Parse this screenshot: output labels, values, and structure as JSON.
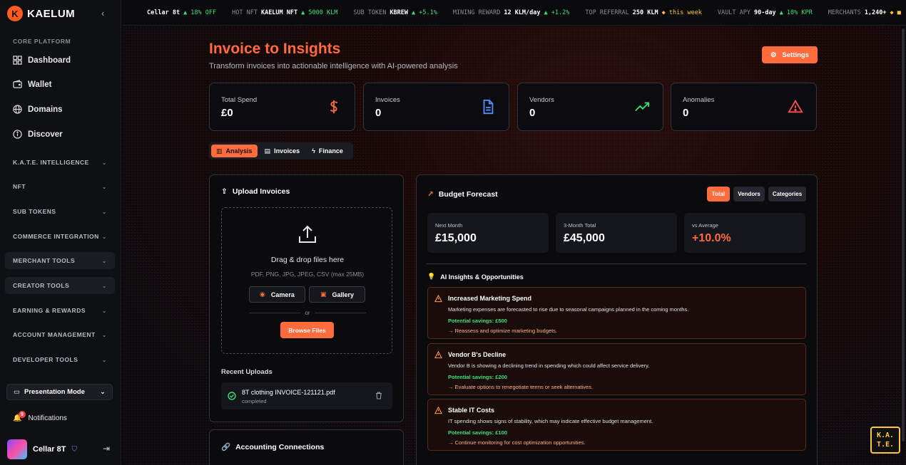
{
  "brand": {
    "name": "KAELUM",
    "logo_letter": "K"
  },
  "sidebar": {
    "core_label": "CORE PLATFORM",
    "items": [
      {
        "label": "Dashboard",
        "icon": "grid-icon"
      },
      {
        "label": "Wallet",
        "icon": "wallet-icon"
      },
      {
        "label": "Domains",
        "icon": "globe-icon"
      },
      {
        "label": "Discover",
        "icon": "compass-icon"
      }
    ],
    "groups": [
      "K.A.T.E. INTELLIGENCE",
      "NFT",
      "SUB TOKENS",
      "COMMERCE INTEGRATION",
      "MERCHANT TOOLS",
      "CREATOR TOOLS",
      "EARNING & REWARDS",
      "ACCOUNT MANAGEMENT",
      "DEVELOPER TOOLS"
    ],
    "presentation_mode": "Presentation Mode",
    "notifications": "Notifications",
    "notif_count": "9",
    "user_name": "Cellar 8T"
  },
  "ticker": [
    {
      "k": "",
      "v": "Cellar 8t",
      "d": "▲ 18% OFF",
      "c": "up"
    },
    {
      "k": "HOT NFT",
      "v": "KAELUM NFT",
      "d": "▲ 5000 KLM",
      "c": "up"
    },
    {
      "k": "SUB TOKEN",
      "v": "KBREW",
      "d": "▲ +5.1%",
      "c": "up"
    },
    {
      "k": "MINING REWARD",
      "v": "12 KLM/day",
      "d": "▲ +1.2%",
      "c": "up"
    },
    {
      "k": "TOP REFERRAL",
      "v": "250 KLM",
      "d": "◆ this week",
      "c": "gold"
    },
    {
      "k": "VAULT APY",
      "v": "90-day",
      "d": "▲ 10% KPR",
      "c": "up"
    },
    {
      "k": "MERCHANTS",
      "v": "1,240+",
      "d": "◆ ■",
      "c": "gold"
    }
  ],
  "header": {
    "title": "Invoice to Insights",
    "subtitle": "Transform invoices into actionable intelligence with AI-powered analysis",
    "settings": "Settings"
  },
  "stats": [
    {
      "label": "Total Spend",
      "value": "£0",
      "icon": "dollar-icon",
      "color": "#ff6b3d"
    },
    {
      "label": "Invoices",
      "value": "0",
      "icon": "document-icon",
      "color": "#4d8dff"
    },
    {
      "label": "Vendors",
      "value": "0",
      "icon": "trend-up-icon",
      "color": "#3ee07a"
    },
    {
      "label": "Anomalies",
      "value": "0",
      "icon": "warning-icon",
      "color": "#ff4d4d"
    }
  ],
  "tabs": [
    {
      "label": "Analysis",
      "active": true
    },
    {
      "label": "Invoices",
      "active": false
    },
    {
      "label": "Finance",
      "active": false
    }
  ],
  "upload": {
    "title": "Upload Invoices",
    "drag_text": "Drag & drop files here",
    "formats": "PDF, PNG, JPG, JPEG, CSV (max 25MB)",
    "camera": "Camera",
    "gallery": "Gallery",
    "or": "or",
    "browse": "Browse Files",
    "recent_label": "Recent Uploads",
    "recent": [
      {
        "name": "8T clothing INVOICE-121121.pdf",
        "status": "completed"
      }
    ]
  },
  "accounting": {
    "title": "Accounting Connections"
  },
  "forecast": {
    "title": "Budget Forecast",
    "segments": [
      {
        "label": "Total",
        "active": true
      },
      {
        "label": "Vendors",
        "active": false
      },
      {
        "label": "Categories",
        "active": false
      }
    ],
    "cards": [
      {
        "label": "Next Month",
        "value": "£15,000"
      },
      {
        "label": "3-Month Total",
        "value": "£45,000"
      },
      {
        "label": "vs Average",
        "value": "+10.0%"
      }
    ],
    "insights_title": "AI Insights & Opportunities",
    "insights": [
      {
        "title": "Increased Marketing Spend",
        "desc": "Marketing expenses are forecasted to rise due to seasonal campaigns planned in the coming months.",
        "savings": "Potential savings: £500",
        "rec": "→ Reassess and optimize marketing budgets."
      },
      {
        "title": "Vendor B's Decline",
        "desc": "Vendor B is showing a declining trend in spending which could affect service delivery.",
        "savings": "Potential savings: £200",
        "rec": "→ Evaluate options to renegotiate terms or seek alternatives."
      },
      {
        "title": "Stable IT Costs",
        "desc": "IT spending shows signs of stability, which may indicate effective budget management.",
        "savings": "Potential savings: £100",
        "rec": "→ Continue monitoring for cost optimization opportunities."
      }
    ]
  },
  "kate_badge": {
    "line1": "K.A.",
    "line2": "T.E."
  }
}
